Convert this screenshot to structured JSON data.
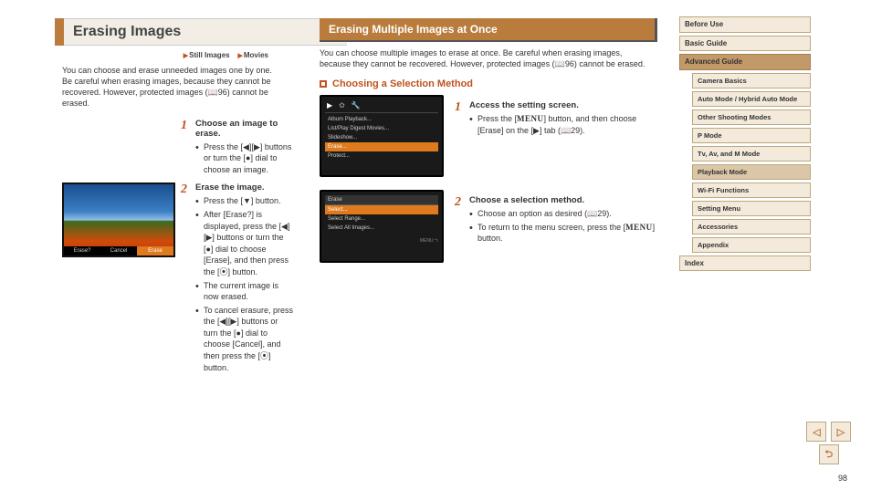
{
  "col1": {
    "heading": "Erasing Images",
    "tag_still": "Still Images",
    "tag_movies": "Movies",
    "intro": "You can choose and erase unneeded images one by one. Be careful when erasing images, because they cannot be recovered. However, protected images (📖96) cannot be erased.",
    "step1": {
      "num": "1",
      "title": "Choose an image to erase.",
      "b1": "Press the [◀][▶] buttons or turn the [●] dial to choose an image."
    },
    "step2": {
      "num": "2",
      "title": "Erase the image.",
      "b1": "Press the [▼] button.",
      "b2": "After [Erase?] is displayed, press the [◀][▶] buttons or turn the [●] dial to choose [Erase], and then press the [⦿] button.",
      "b3": "The current image is now erased.",
      "b4": "To cancel erasure, press the [◀][▶] buttons or turn the [●] dial to choose [Cancel], and then press the [⦿] button."
    },
    "photo": {
      "b1": "Erase?",
      "b2": "Cancel",
      "b3": "Erase"
    }
  },
  "col2": {
    "heading": "Erasing Multiple Images at Once",
    "intro": "You can choose multiple images to erase at once. Be careful when erasing images, because they cannot be recovered. However, protected images (📖96) cannot be erased.",
    "subheading": "Choosing a Selection Method",
    "s1": {
      "menu": {
        "r1": "Album Playback...",
        "r2": "List/Play Digest Movies...",
        "r3": "Slideshow...",
        "r4": "Erase...",
        "r5": "Protect..."
      }
    },
    "step1": {
      "num": "1",
      "title": "Access the setting screen.",
      "b1_a": "Press the [",
      "b1_menu": "MENU",
      "b1_b": "] button, and then choose [Erase] on the [▶] tab (📖29)."
    },
    "s2": {
      "menu": {
        "hd": "Erase",
        "r1": "Select...",
        "r2": "Select Range...",
        "r3": "Select All Images...",
        "ft": "MENU ⮌"
      }
    },
    "step2": {
      "num": "2",
      "title": "Choose a selection method.",
      "b1": "Choose an option as desired (📖29).",
      "b2_a": "To return to the menu screen, press the [",
      "b2_menu": "MENU",
      "b2_b": "] button."
    }
  },
  "nav": {
    "i1": "Before Use",
    "i2": "Basic Guide",
    "i3": "Advanced Guide",
    "s1": "Camera Basics",
    "s2": "Auto Mode / Hybrid Auto Mode",
    "s3": "Other Shooting Modes",
    "s4": "P Mode",
    "s5": "Tv, Av, and M Mode",
    "s6": "Playback Mode",
    "s7": "Wi-Fi Functions",
    "s8": "Setting Menu",
    "s9": "Accessories",
    "s10": "Appendix",
    "i4": "Index"
  },
  "pager": {
    "prev": "◁",
    "next": "▷",
    "back": "⮌"
  },
  "pagenum": "98"
}
